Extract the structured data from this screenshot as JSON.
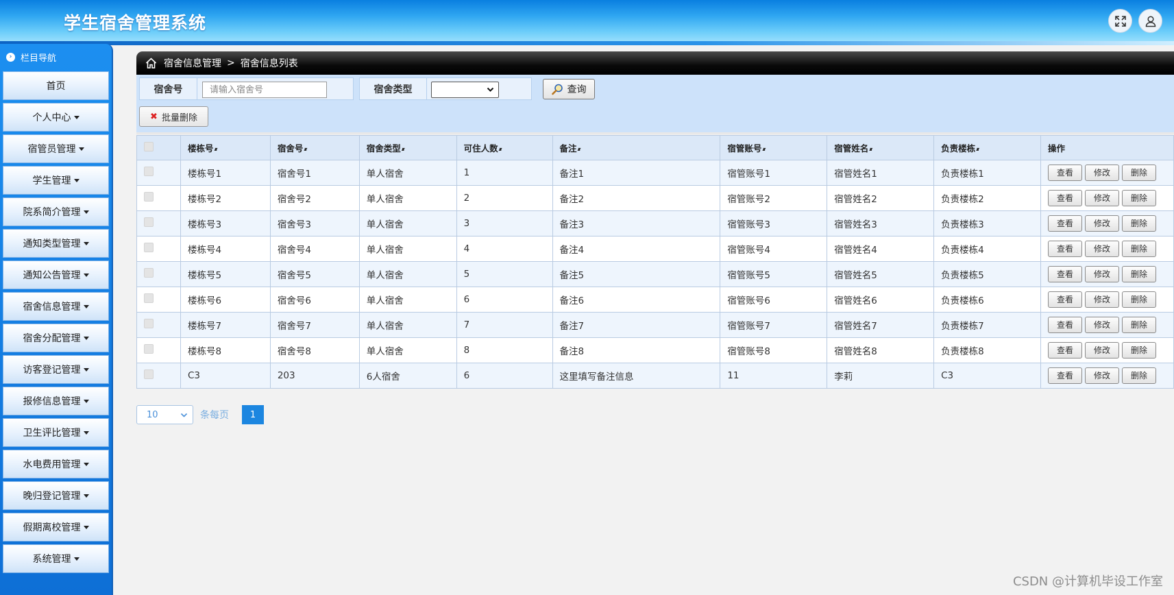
{
  "app": {
    "title": "学生宿舍管理系统"
  },
  "header": {
    "fullscreen_icon": "expand-icon",
    "user_icon": "user-icon"
  },
  "sidebar": {
    "heading": "栏目导航",
    "items": [
      {
        "label": "首页",
        "dropdown": false
      },
      {
        "label": "个人中心",
        "dropdown": true
      },
      {
        "label": "宿管员管理",
        "dropdown": true
      },
      {
        "label": "学生管理",
        "dropdown": true
      },
      {
        "label": "院系简介管理",
        "dropdown": true
      },
      {
        "label": "通知类型管理",
        "dropdown": true
      },
      {
        "label": "通知公告管理",
        "dropdown": true
      },
      {
        "label": "宿舍信息管理",
        "dropdown": true
      },
      {
        "label": "宿舍分配管理",
        "dropdown": true
      },
      {
        "label": "访客登记管理",
        "dropdown": true
      },
      {
        "label": "报修信息管理",
        "dropdown": true
      },
      {
        "label": "卫生评比管理",
        "dropdown": true
      },
      {
        "label": "水电费用管理",
        "dropdown": true
      },
      {
        "label": "晚归登记管理",
        "dropdown": true
      },
      {
        "label": "假期离校管理",
        "dropdown": true
      },
      {
        "label": "系统管理",
        "dropdown": true
      }
    ]
  },
  "breadcrumb": {
    "section": "宿舍信息管理",
    "separator": ">",
    "page": "宿舍信息列表"
  },
  "search": {
    "room_label": "宿舍号",
    "room_placeholder": "请输入宿舍号",
    "room_value": "",
    "type_label": "宿舍类型",
    "type_value": "",
    "query_label": "查询",
    "batch_delete_label": "批量删除"
  },
  "table": {
    "columns": [
      "楼栋号",
      "宿舍号",
      "宿舍类型",
      "可住人数",
      "备注",
      "宿管账号",
      "宿管姓名",
      "负责楼栋",
      "操作"
    ],
    "actions": {
      "view": "查看",
      "edit": "修改",
      "delete": "删除"
    },
    "rows": [
      [
        "楼栋号1",
        "宿舍号1",
        "单人宿舍",
        "1",
        "备注1",
        "宿管账号1",
        "宿管姓名1",
        "负责楼栋1"
      ],
      [
        "楼栋号2",
        "宿舍号2",
        "单人宿舍",
        "2",
        "备注2",
        "宿管账号2",
        "宿管姓名2",
        "负责楼栋2"
      ],
      [
        "楼栋号3",
        "宿舍号3",
        "单人宿舍",
        "3",
        "备注3",
        "宿管账号3",
        "宿管姓名3",
        "负责楼栋3"
      ],
      [
        "楼栋号4",
        "宿舍号4",
        "单人宿舍",
        "4",
        "备注4",
        "宿管账号4",
        "宿管姓名4",
        "负责楼栋4"
      ],
      [
        "楼栋号5",
        "宿舍号5",
        "单人宿舍",
        "5",
        "备注5",
        "宿管账号5",
        "宿管姓名5",
        "负责楼栋5"
      ],
      [
        "楼栋号6",
        "宿舍号6",
        "单人宿舍",
        "6",
        "备注6",
        "宿管账号6",
        "宿管姓名6",
        "负责楼栋6"
      ],
      [
        "楼栋号7",
        "宿舍号7",
        "单人宿舍",
        "7",
        "备注7",
        "宿管账号7",
        "宿管姓名7",
        "负责楼栋7"
      ],
      [
        "楼栋号8",
        "宿舍号8",
        "单人宿舍",
        "8",
        "备注8",
        "宿管账号8",
        "宿管姓名8",
        "负责楼栋8"
      ],
      [
        "C3",
        "203",
        "6人宿舍",
        "6",
        "这里填写备注信息",
        "11",
        "李莉",
        "C3"
      ]
    ]
  },
  "pagination": {
    "page_size": "10",
    "per_page_label": "条每页",
    "current_page": "1"
  },
  "watermark": "CSDN @计算机毕设工作室",
  "colors": {
    "header_blue": "#0a7fe0",
    "sidebar_blue": "#1c8ff0",
    "page_active": "#1c86e0"
  }
}
